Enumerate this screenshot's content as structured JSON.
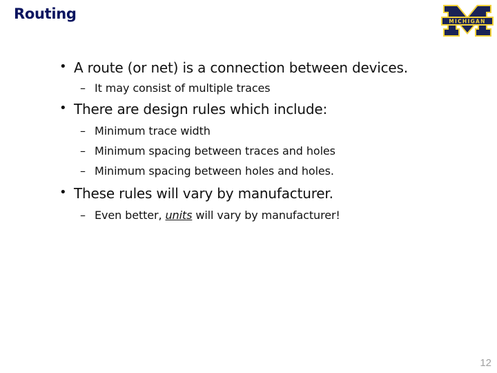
{
  "slide": {
    "title": "Routing",
    "logo": {
      "text": "MICHIGAN",
      "colors": {
        "navy": "#1a2356",
        "maize": "#f3d23a"
      }
    },
    "bullets": [
      {
        "text": "A route (or net) is a connection between devices.",
        "sub": [
          "It may consist of multiple traces"
        ]
      },
      {
        "text": "There are design rules which include:",
        "sub": [
          "Minimum trace width",
          "Minimum spacing between traces and holes",
          "Minimum spacing between holes and holes."
        ]
      },
      {
        "text": "These rules will vary by manufacturer.",
        "sub_rich": {
          "before": "Even better, ",
          "emphasis": "units",
          "after": " will vary by manufacturer!"
        }
      }
    ],
    "bullet_glyph": "•",
    "dash_glyph": "–",
    "page_number": "12"
  }
}
